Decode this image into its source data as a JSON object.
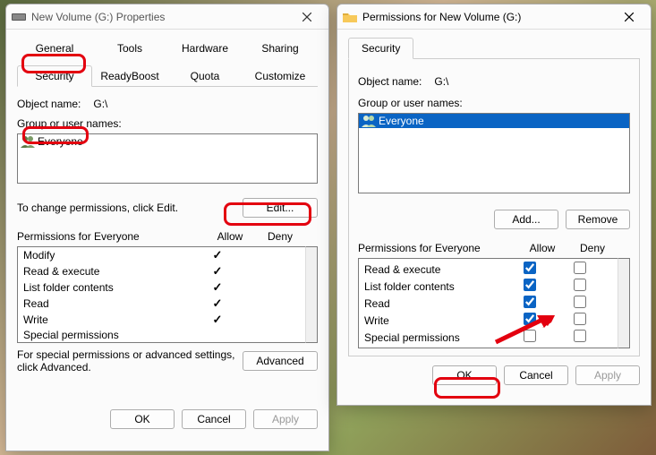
{
  "win1": {
    "title": "New Volume (G:) Properties",
    "tabs_row1": [
      "General",
      "Tools",
      "Hardware",
      "Sharing"
    ],
    "tabs_row2": [
      "Security",
      "ReadyBoost",
      "Quota",
      "Customize"
    ],
    "active_tab": "Security",
    "object_name_label": "Object name:",
    "object_name_value": "G:\\",
    "group_label": "Group or user names:",
    "groups": [
      "Everyone"
    ],
    "edit_hint": "To change permissions, click Edit.",
    "edit_btn": "Edit...",
    "perm_header": "Permissions for Everyone",
    "perm_allow": "Allow",
    "perm_deny": "Deny",
    "perms": [
      {
        "name": "Modify",
        "allow": true,
        "deny": false
      },
      {
        "name": "Read & execute",
        "allow": true,
        "deny": false
      },
      {
        "name": "List folder contents",
        "allow": true,
        "deny": false
      },
      {
        "name": "Read",
        "allow": true,
        "deny": false
      },
      {
        "name": "Write",
        "allow": true,
        "deny": false
      },
      {
        "name": "Special permissions",
        "allow": false,
        "deny": false
      }
    ],
    "adv_hint": "For special permissions or advanced settings, click Advanced.",
    "adv_btn": "Advanced",
    "ok": "OK",
    "cancel": "Cancel",
    "apply": "Apply"
  },
  "win2": {
    "title": "Permissions for New Volume (G:)",
    "tab": "Security",
    "object_name_label": "Object name:",
    "object_name_value": "G:\\",
    "group_label": "Group or user names:",
    "groups": [
      "Everyone"
    ],
    "add_btn": "Add...",
    "remove_btn": "Remove",
    "perm_header": "Permissions for Everyone",
    "perm_allow": "Allow",
    "perm_deny": "Deny",
    "perms": [
      {
        "name": "Read & execute",
        "allow": true,
        "deny": false
      },
      {
        "name": "List folder contents",
        "allow": true,
        "deny": false
      },
      {
        "name": "Read",
        "allow": true,
        "deny": false
      },
      {
        "name": "Write",
        "allow": true,
        "deny": false
      },
      {
        "name": "Special permissions",
        "allow": false,
        "deny": false
      }
    ],
    "ok": "OK",
    "cancel": "Cancel",
    "apply": "Apply"
  }
}
